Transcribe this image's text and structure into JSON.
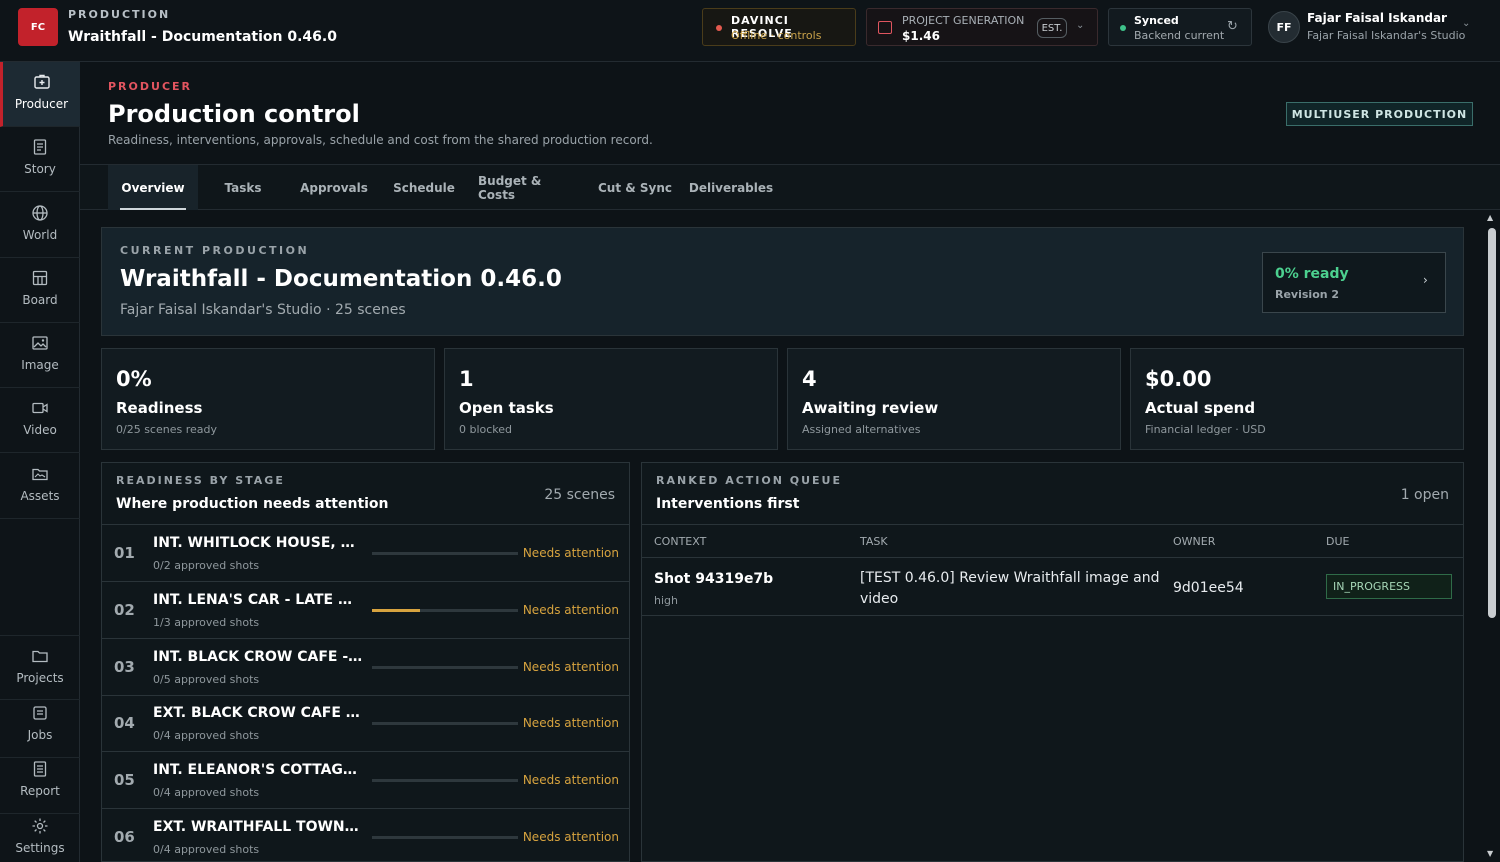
{
  "app": {
    "logo": "FC",
    "kicker": "PRODUCTION",
    "title": "Wraithfall - Documentation 0.46.0"
  },
  "topbar": {
    "davinci": {
      "title": "DAVINCI RESOLVE",
      "status": "Offline · controls"
    },
    "generation": {
      "label": "PROJECT GENERATION",
      "amount": "$1.46",
      "badge": "EST."
    },
    "sync": {
      "title": "Synced",
      "status": "Backend current"
    },
    "user": {
      "initials": "FF",
      "name": "Fajar Faisal Iskandar",
      "studio": "Fajar Faisal Iskandar's Studio"
    }
  },
  "sidebar": {
    "items": [
      {
        "label": "Producer",
        "icon": "producer-icon"
      },
      {
        "label": "Story",
        "icon": "story-icon"
      },
      {
        "label": "World",
        "icon": "globe-icon"
      },
      {
        "label": "Board",
        "icon": "board-icon"
      },
      {
        "label": "Image",
        "icon": "image-icon"
      },
      {
        "label": "Video",
        "icon": "video-icon"
      },
      {
        "label": "Assets",
        "icon": "folder-icon"
      }
    ],
    "bottom_items": [
      {
        "label": "Projects",
        "icon": "folder-icon"
      },
      {
        "label": "Jobs",
        "icon": "jobs-icon"
      },
      {
        "label": "Report",
        "icon": "report-icon"
      },
      {
        "label": "Settings",
        "icon": "gear-icon"
      }
    ]
  },
  "header": {
    "kicker": "PRODUCER",
    "title": "Production control",
    "subtitle": "Readiness, interventions, approvals, schedule and cost from the shared production record.",
    "badge": "MULTIUSER PRODUCTION"
  },
  "tabs": [
    "Overview",
    "Tasks",
    "Approvals",
    "Schedule",
    "Budget & Costs",
    "Cut & Sync",
    "Deliverables"
  ],
  "hero": {
    "kicker": "CURRENT PRODUCTION",
    "title": "Wraithfall - Documentation 0.46.0",
    "subtitle": "Fajar Faisal Iskandar's Studio · 25 scenes",
    "ready_pct": "0% ready",
    "revision": "Revision 2"
  },
  "stats": [
    {
      "value": "0%",
      "label": "Readiness",
      "sub": "0/25 scenes ready"
    },
    {
      "value": "1",
      "label": "Open tasks",
      "sub": "0 blocked"
    },
    {
      "value": "4",
      "label": "Awaiting review",
      "sub": "Assigned alternatives"
    },
    {
      "value": "$0.00",
      "label": "Actual spend",
      "sub": "Financial ledger · USD"
    }
  ],
  "readiness": {
    "kicker": "READINESS BY STAGE",
    "title": "Where production needs attention",
    "count": "25 scenes",
    "rows": [
      {
        "num": "01",
        "name": "INT. WHITLOCK HOUSE, S...",
        "sub": "0/2 approved shots",
        "progress": 0,
        "status": "Needs attention"
      },
      {
        "num": "02",
        "name": "INT. LENA'S CAR - LATE A...",
        "sub": "1/3 approved shots",
        "progress": 0.33,
        "status": "Needs attention"
      },
      {
        "num": "03",
        "name": "INT. BLACK CROW CAFE - ...",
        "sub": "0/5 approved shots",
        "progress": 0,
        "status": "Needs attention"
      },
      {
        "num": "04",
        "name": "EXT. BLACK CROW CAFE - ...",
        "sub": "0/4 approved shots",
        "progress": 0,
        "status": "Needs attention"
      },
      {
        "num": "05",
        "name": "INT. ELEANOR'S COTTAGE ...",
        "sub": "0/4 approved shots",
        "progress": 0,
        "status": "Needs attention"
      },
      {
        "num": "06",
        "name": "EXT. WRAITHFALL TOWN ...",
        "sub": "0/4 approved shots",
        "progress": 0,
        "status": "Needs attention"
      }
    ]
  },
  "queue": {
    "kicker": "RANKED ACTION QUEUE",
    "title": "Interventions first",
    "count": "1 open",
    "columns": [
      "CONTEXT",
      "TASK",
      "OWNER",
      "DUE"
    ],
    "rows": [
      {
        "context": "Shot 94319e7b",
        "priority": "high",
        "task": "[TEST 0.46.0] Review Wraithfall image and video",
        "owner": "9d01ee54",
        "status": "IN_PROGRESS"
      }
    ]
  }
}
